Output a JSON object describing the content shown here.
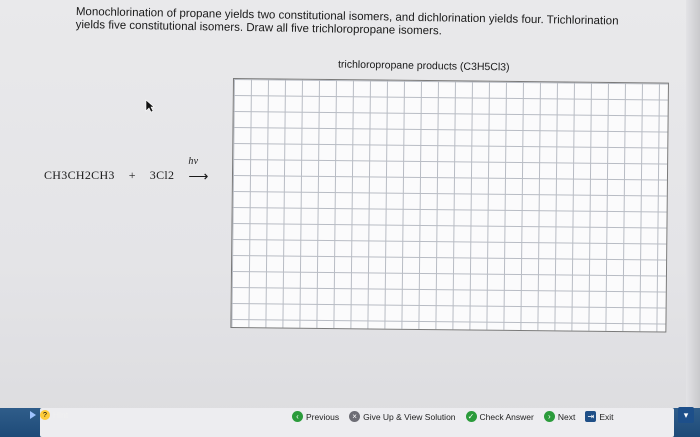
{
  "prompt": {
    "line1": "Monochlorination of propane yields two constitutional isomers, and dichlorination yields four. Trichlorination",
    "line2": "yields five constitutional isomers. Draw all five trichloropropane isomers."
  },
  "grid": {
    "caption": "trichloropropane products (C3H5Cl3)"
  },
  "equation": {
    "reactant": "CH3CH2CH3",
    "plus": "+",
    "reagent": "3Cl2",
    "condition": "hv",
    "arrow": "⟶"
  },
  "footer": {
    "hint": "Hint",
    "previous": "Previous",
    "give_up": "Give Up & View Solution",
    "check": "Check Answer",
    "next": "Next",
    "exit": "Exit"
  }
}
